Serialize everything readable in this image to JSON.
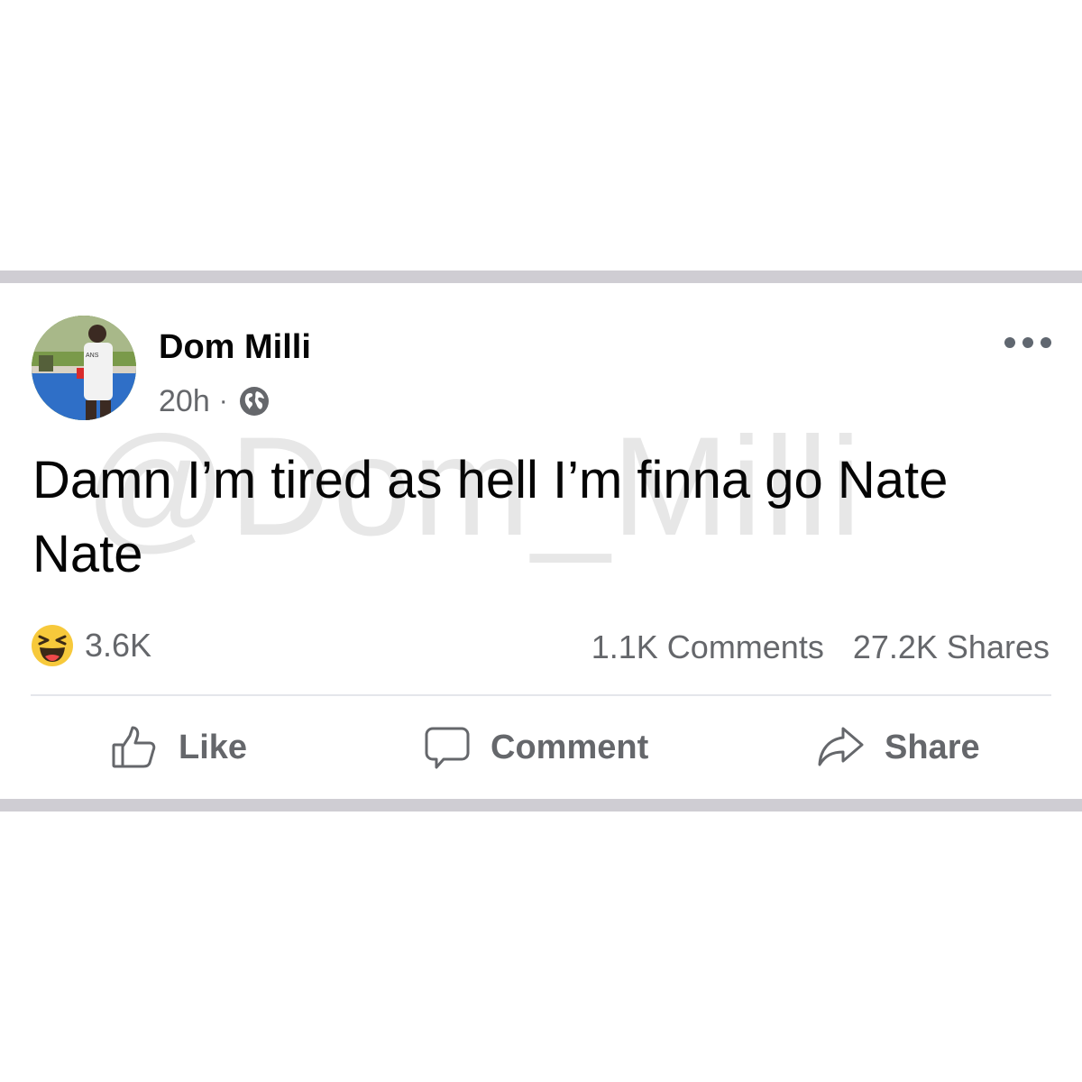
{
  "post": {
    "author": "Dom Milli",
    "timestamp": "20h",
    "separator": "·",
    "audience_icon": "globe-icon",
    "text": "Damn I’m tired as hell I’m finna go Nate Nate",
    "watermark": "@Dom_Milli"
  },
  "stats": {
    "reaction_icon": "haha-emoji-icon",
    "reaction_count": "3.6K",
    "comments": "1.1K Comments",
    "shares": "27.2K Shares"
  },
  "actions": {
    "like": "Like",
    "comment": "Comment",
    "share": "Share"
  },
  "colors": {
    "divider_band": "#cfcdd3",
    "primary_text": "#050505",
    "secondary_text": "#65676b",
    "watermark": "#e7e7e7",
    "reaction_yellow": "#f7c93b"
  }
}
